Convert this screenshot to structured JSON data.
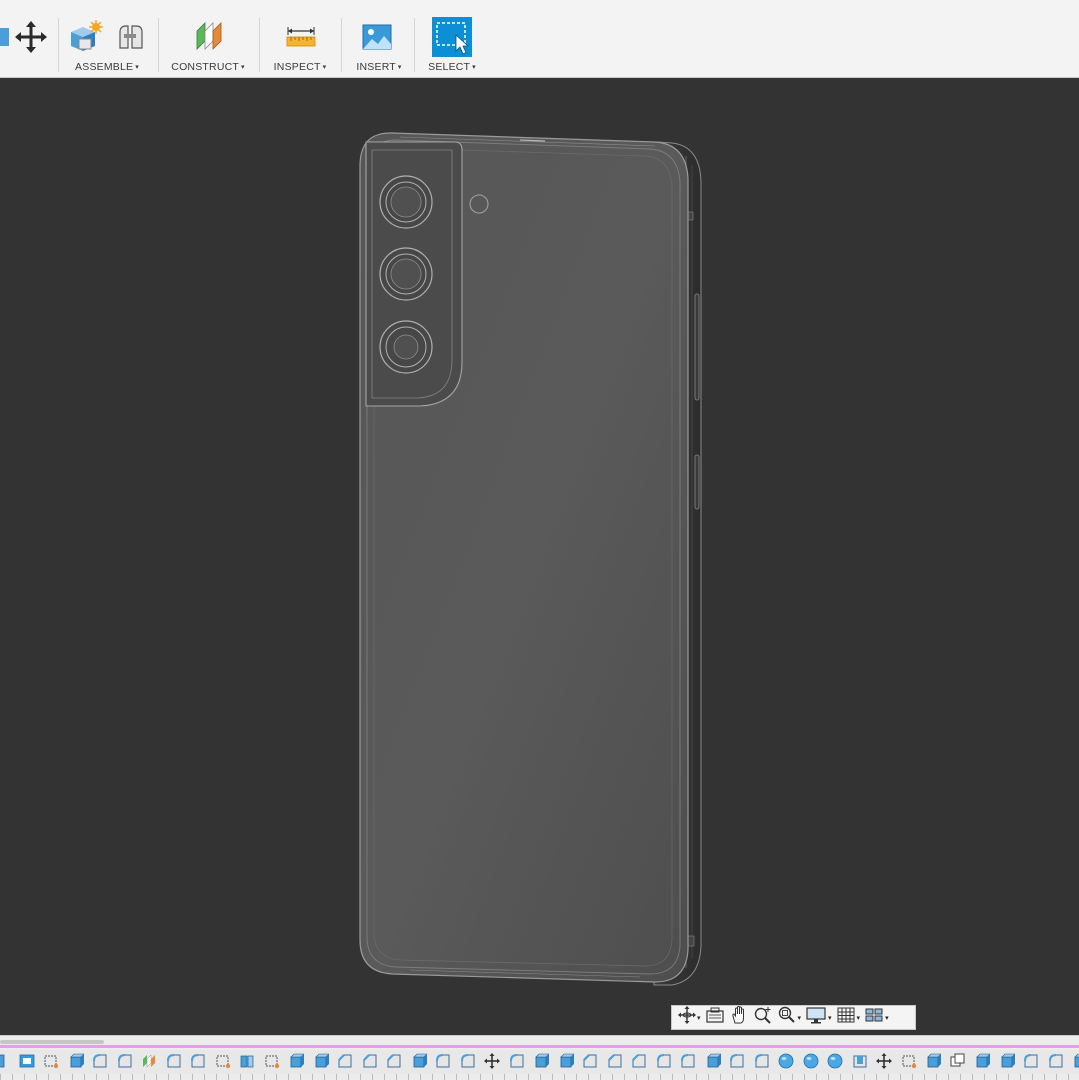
{
  "toolbar": {
    "groups": [
      {
        "label": "ASSEMBLE",
        "icons": [
          "new-component-icon",
          "joint-icon"
        ]
      },
      {
        "label": "CONSTRUCT",
        "icons": [
          "construct-plane-icon"
        ]
      },
      {
        "label": "INSPECT",
        "icons": [
          "measure-icon"
        ]
      },
      {
        "label": "INSERT",
        "icons": [
          "insert-image-icon"
        ]
      },
      {
        "label": "SELECT",
        "icons": [
          "select-window-icon"
        ]
      }
    ],
    "leading_icons": [
      "move-icon"
    ],
    "dropdown_caret": "▾"
  },
  "viewport": {
    "background": "#333333",
    "model": "phone-back-wireframe"
  },
  "navbar": {
    "tools": [
      "orbit-icon",
      "look-at-icon",
      "pan-icon",
      "zoom-icon",
      "fit-icon",
      "display-settings-icon",
      "grid-settings-icon",
      "viewports-icon"
    ]
  },
  "timeline": {
    "marker_color": "#e3a0e6",
    "feature_icons": [
      "body-icon",
      "image-icon",
      "sketch-icon",
      "extrude-icon",
      "fillet-icon",
      "fillet-icon",
      "construct-plane-icon",
      "fillet-icon",
      "fillet-icon",
      "sketch-icon",
      "split-icon",
      "sketch-icon",
      "extrude-icon",
      "extrude-icon",
      "chamfer-icon",
      "chamfer-icon",
      "chamfer-icon",
      "extrude-icon",
      "fillet-icon",
      "fillet-icon",
      "move-icon",
      "fillet-icon",
      "extrude-icon",
      "extrude-icon",
      "chamfer-icon",
      "chamfer-icon",
      "chamfer-icon",
      "fillet-icon",
      "fillet-icon",
      "extrude-icon",
      "fillet-icon",
      "fillet-icon",
      "sphere-icon",
      "sphere-icon",
      "sphere-icon",
      "shell-icon",
      "move-icon",
      "sketch-icon",
      "extrude-icon",
      "copy-icon",
      "extrude-icon",
      "extrude-icon",
      "fillet-icon",
      "fillet-icon",
      "extrude-icon"
    ]
  }
}
